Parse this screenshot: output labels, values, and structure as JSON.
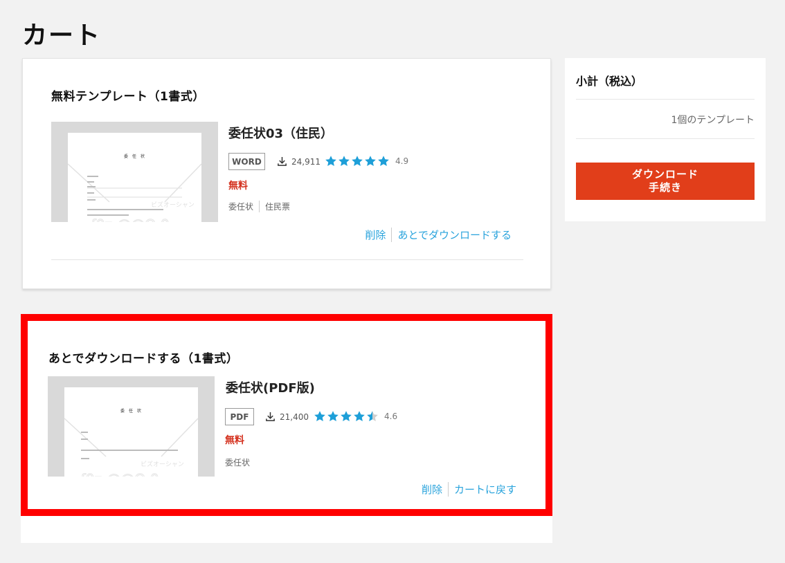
{
  "page": {
    "title": "カート"
  },
  "free_section": {
    "heading": "無料テンプレート（1書式）",
    "item": {
      "title": "委任状03（住民）",
      "format": "WORD",
      "downloads": "24,911",
      "rating": 4.9,
      "rating_text": "4.9",
      "price": "無料",
      "tags": [
        "委任状",
        "住民票"
      ],
      "thumbnail": {
        "heading": "委　任　状",
        "watermark": "ビズオーシャン"
      },
      "actions": {
        "delete": "削除",
        "later": "あとでダウンロードする"
      }
    }
  },
  "later_section": {
    "heading": "あとでダウンロードする（1書式）",
    "item": {
      "title": "委任状(PDF版)",
      "format": "PDF",
      "downloads": "21,400",
      "rating": 4.6,
      "rating_text": "4.6",
      "price": "無料",
      "tags": [
        "委任状"
      ],
      "thumbnail": {
        "heading": "委　任　状",
        "watermark": "ビズオーシャン"
      },
      "actions": {
        "delete": "削除",
        "back": "カートに戻す"
      }
    }
  },
  "summary": {
    "title": "小計（税込）",
    "count": "1個のテンプレート",
    "button_line1": "ダウンロード",
    "button_line2": "手続き"
  },
  "colors": {
    "accent_link": "#29a3dc",
    "star": "#1e9fd8",
    "price": "#d4311e",
    "checkout": "#e13e1a",
    "highlight_border": "#ff0000"
  },
  "icons": {
    "download": "download-icon",
    "star": "star-icon"
  }
}
